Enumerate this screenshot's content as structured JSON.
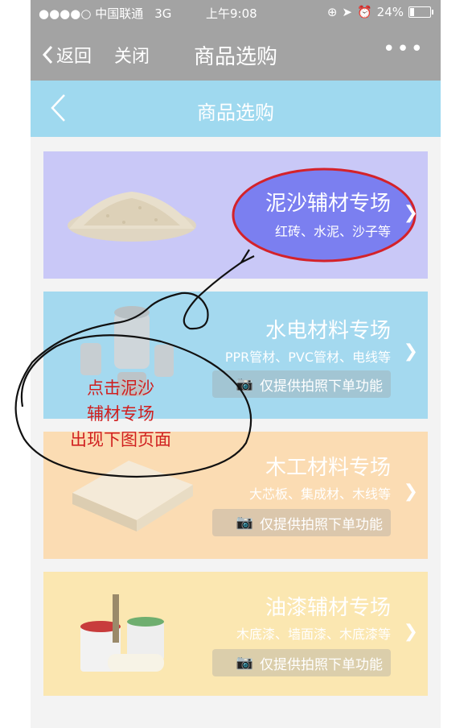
{
  "status_bar": {
    "carrier": "●●●●○ 中国联通",
    "network": "3G",
    "time": "上午9:08",
    "battery": "24%",
    "battery_level": 0.24
  },
  "nav_bar": {
    "back_label": "返回",
    "close_label": "关闭",
    "title": "商品选购",
    "more_label": "•••"
  },
  "page_header": {
    "title": "商品选购"
  },
  "categories": [
    {
      "name": "泥沙辅材专场",
      "desc": "红砖、水泥、沙子等",
      "photo_label": ""
    },
    {
      "name": "水电材料专场",
      "desc": "PPR管材、PVC管材、电线等",
      "photo_label": "仅提供拍照下单功能"
    },
    {
      "name": "木工材料专场",
      "desc": "大芯板、集成材、木线等",
      "photo_label": "仅提供拍照下单功能"
    },
    {
      "name": "油漆辅材专场",
      "desc": "木底漆、墙面漆、木底漆等",
      "photo_label": "仅提供拍照下单功能"
    }
  ],
  "annotation": {
    "lines": [
      "点击泥沙",
      "辅材专场",
      "出现下图页面"
    ],
    "color": "#d01f1f"
  },
  "colors": {
    "nav_gray": "#a3a3a3",
    "header_blue": "#9fd9ef",
    "highlight_fill": "#7b7ff0",
    "highlight_stroke": "#d4222a"
  }
}
